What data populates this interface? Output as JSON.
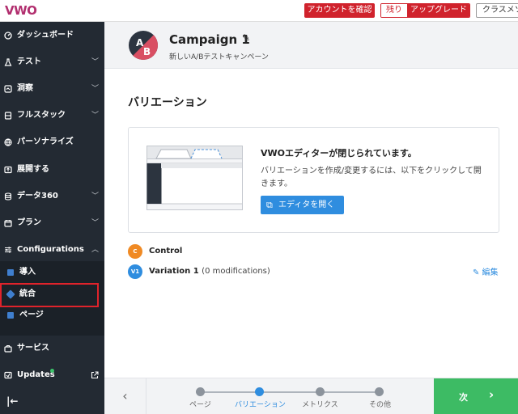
{
  "topbar": {
    "logo": "VWO",
    "confirm_account": "アカウントを確認",
    "remaining": "残り",
    "upgrade": "アップグレード",
    "class_menu": "クラスメソ"
  },
  "sidebar": {
    "items": [
      {
        "label": "ダッシュボード",
        "icon": "gauge-icon"
      },
      {
        "label": "テスト",
        "icon": "flask-icon"
      },
      {
        "label": "洞察",
        "icon": "insights-icon"
      },
      {
        "label": "フルスタック",
        "icon": "stack-icon"
      },
      {
        "label": "パーソナライズ",
        "icon": "globe-icon"
      },
      {
        "label": "展開する",
        "icon": "deploy-icon"
      },
      {
        "label": "データ360",
        "icon": "database-icon"
      },
      {
        "label": "プラン",
        "icon": "calendar-icon"
      },
      {
        "label": "Configurations",
        "icon": "sliders-icon"
      }
    ],
    "sub_items": [
      {
        "label": "導入",
        "icon": "install-icon"
      },
      {
        "label": "統合",
        "icon": "plug-icon"
      },
      {
        "label": "ページ",
        "icon": "page-icon"
      }
    ],
    "bottom_items": [
      {
        "label": "サービス",
        "icon": "briefcase-icon"
      },
      {
        "label": "Updates",
        "icon": "updates-icon"
      }
    ],
    "collapse": "|←"
  },
  "header": {
    "title": "Campaign 1",
    "subtitle": "新しいA/Bテストキャンペーン",
    "avatar_a": "A",
    "avatar_b": "B"
  },
  "main": {
    "section_title": "バリエーション",
    "card": {
      "heading": "VWOエディターが閉じられています。",
      "text": "バリエーションを作成/変更するには、以下をクリックして開きます。",
      "button": "エディタを開く"
    },
    "variations": [
      {
        "badge": "C",
        "name": "Control",
        "mods": "",
        "color": "#f08a24"
      },
      {
        "badge": "V1",
        "name": "Variation 1",
        "mods": "(0 modifications)",
        "color": "#2f8ddf"
      }
    ],
    "edit_label": "✎ 編集"
  },
  "footer": {
    "back": "‹",
    "steps": [
      {
        "label": "ページ",
        "active": false
      },
      {
        "label": "バリエーション",
        "active": true
      },
      {
        "label": "メトリクス",
        "active": false
      },
      {
        "label": "その他",
        "active": false
      }
    ],
    "next": "次",
    "next_arrow": "›"
  },
  "colors": {
    "sidebar_bg": "#232a33",
    "accent_blue": "#2f8ddf",
    "danger_red": "#d0222c",
    "next_green": "#3dbb64"
  }
}
